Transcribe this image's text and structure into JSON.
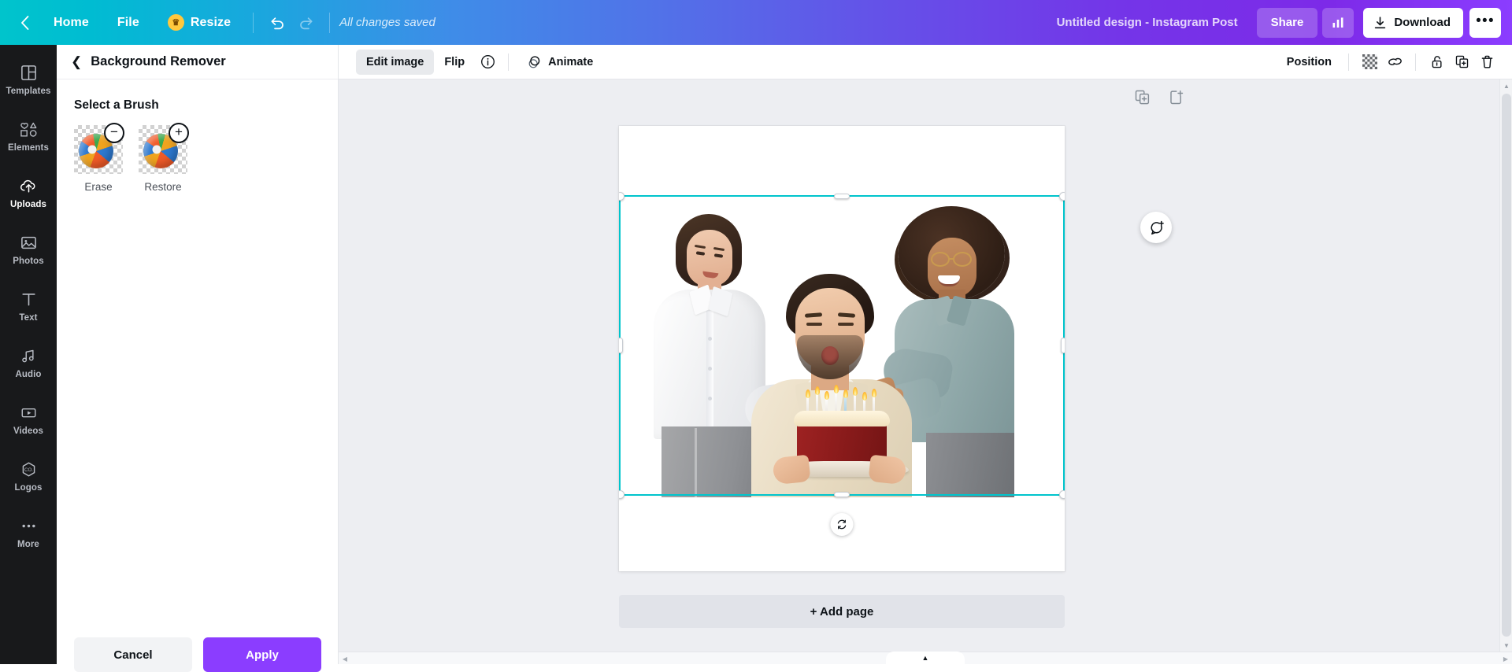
{
  "topbar": {
    "back_icon": "chevron-left-icon",
    "home_label": "Home",
    "file_label": "File",
    "resize_label": "Resize",
    "resize_badge_icon": "crown-icon",
    "undo_icon": "undo-arrow-icon",
    "redo_icon": "redo-arrow-icon",
    "save_status": "All changes saved",
    "doc_title": "Untitled design - Instagram Post",
    "share_label": "Share",
    "insights_icon": "bar-chart-icon",
    "download_label": "Download",
    "download_icon": "download-arrow-icon",
    "more_label": "•••",
    "gradient_start": "#00c4cc",
    "gradient_mid": "#5271e8",
    "gradient_end": "#8b3dff"
  },
  "rail": {
    "items": [
      {
        "label": "Templates",
        "icon": "templates-grid-icon",
        "active": false
      },
      {
        "label": "Elements",
        "icon": "shapes-icon",
        "active": false
      },
      {
        "label": "Uploads",
        "icon": "cloud-upload-icon",
        "active": true
      },
      {
        "label": "Photos",
        "icon": "photo-icon",
        "active": false
      },
      {
        "label": "Text",
        "icon": "text-t-icon",
        "active": false
      },
      {
        "label": "Audio",
        "icon": "music-note-icon",
        "active": false
      },
      {
        "label": "Videos",
        "icon": "video-play-icon",
        "active": false
      },
      {
        "label": "Logos",
        "icon": "logo-hexagon-icon",
        "active": false
      },
      {
        "label": "More",
        "icon": "ellipsis-icon",
        "active": false
      }
    ]
  },
  "panel": {
    "back_icon": "chevron-left-icon",
    "title": "Background Remover",
    "brush_heading": "Select a Brush",
    "brushes": [
      {
        "label": "Erase",
        "badge": "−",
        "icon": "erase-brush-icon"
      },
      {
        "label": "Restore",
        "badge": "+",
        "icon": "restore-brush-icon"
      }
    ],
    "cancel_label": "Cancel",
    "apply_label": "Apply",
    "apply_color": "#8b3dff"
  },
  "editor_toolbar": {
    "edit_image_label": "Edit image",
    "flip_label": "Flip",
    "info_icon": "info-circle-icon",
    "animate_label": "Animate",
    "animate_icon": "animate-circles-icon",
    "position_label": "Position",
    "transparency_icon": "transparency-checker-icon",
    "link_icon": "link-chain-icon",
    "lock_icon": "lock-open-icon",
    "duplicate_icon": "duplicate-icon",
    "delete_icon": "trash-icon"
  },
  "canvas": {
    "duplicate_page_icon": "duplicate-page-icon",
    "add_page_icon": "add-page-icon",
    "comment_icon": "add-comment-icon",
    "rotate_icon": "rotate-icon",
    "add_page_label": "+ Add page",
    "selection_color": "#00c4cc",
    "background": "#edeef2"
  },
  "scrollbars": {
    "up_arrow": "▲",
    "down_arrow": "▼",
    "left_arrow": "◀",
    "right_arrow": "▶",
    "bottom_tab_icon": "▲"
  }
}
